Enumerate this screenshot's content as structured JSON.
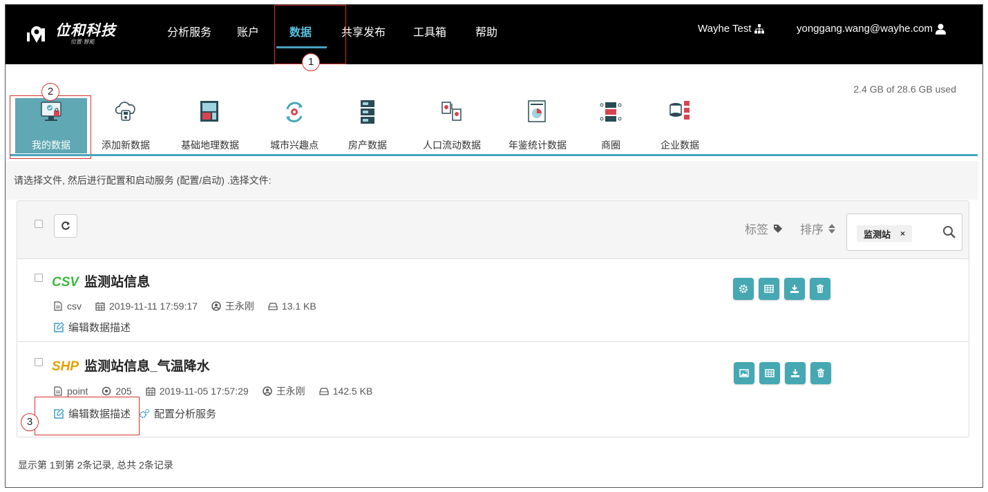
{
  "header": {
    "logo_text": "位和科技",
    "logo_sub": "位置·智能",
    "nav": [
      "分析服务",
      "账户",
      "数据",
      "共享发布",
      "工具箱",
      "帮助"
    ],
    "active_nav": "数据",
    "org": "Wayhe Test",
    "user_email": "yonggang.wang@wayhe.com"
  },
  "storage": "2.4 GB of 28.6 GB used",
  "categories": [
    "我的数据",
    "添加新数据",
    "基础地理数据",
    "城市兴趣点",
    "房产数据",
    "人口流动数据",
    "年鉴统计数据",
    "商圈",
    "企业数据"
  ],
  "hint": "请选择文件, 然后进行配置和启动服务 (配置/启动) .选择文件:",
  "toolbar": {
    "tag_label": "标签",
    "sort_label": "排序",
    "search_tag": "监测站",
    "tag_close": "×"
  },
  "files": [
    {
      "type": "CSV",
      "name": "监测站信息",
      "format": "csv",
      "date": "2019-11-11 17:59:17",
      "owner": "王永刚",
      "size": "13.1 KB",
      "edit_desc": "编辑数据描述"
    },
    {
      "type": "SHP",
      "name": "监测站信息_气温降水",
      "format": "point",
      "count": "205",
      "date": "2019-11-05 17:57:29",
      "owner": "王永刚",
      "size": "142.5 KB",
      "edit_desc": "编辑数据描述",
      "config_service": "配置分析服务"
    }
  ],
  "footer": "显示第 1到第 2条记录, 总共 2条记录",
  "annotations": [
    "1",
    "2",
    "3"
  ],
  "colors": {
    "accent": "#46a3bf",
    "button": "#45a8b3",
    "csv": "#3fb83f",
    "shp": "#e5a000",
    "annotation": "#d9302c"
  }
}
